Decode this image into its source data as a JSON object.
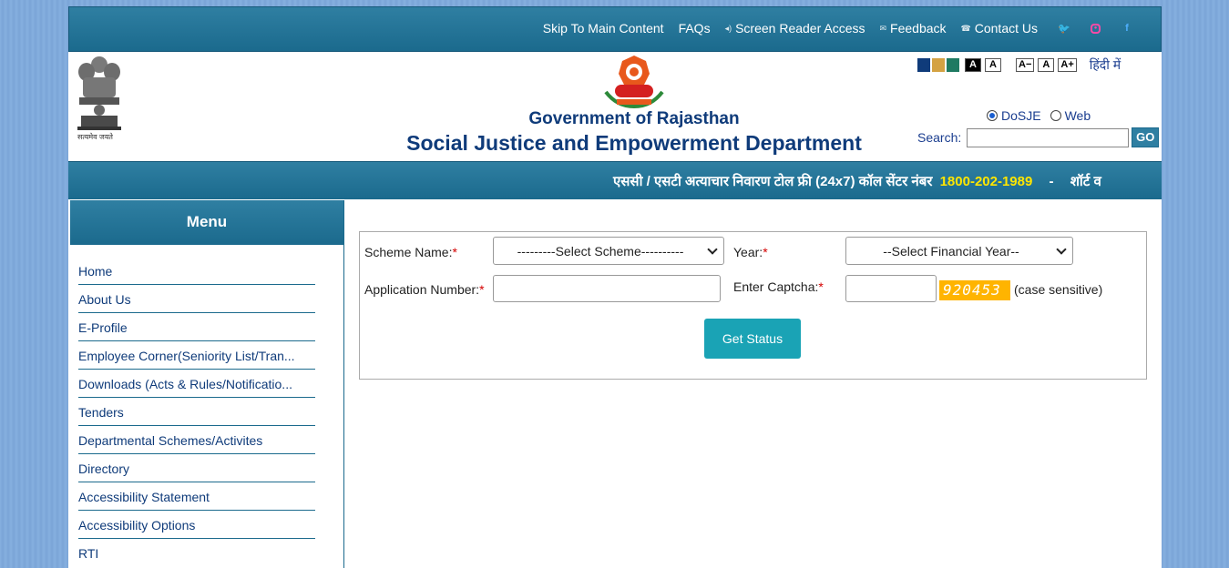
{
  "topnav": {
    "skip": "Skip To Main Content",
    "faqs": "FAQs",
    "screen_reader": "Screen Reader Access",
    "feedback": "Feedback",
    "contact": "Contact Us"
  },
  "header": {
    "emblem_caption": "सत्यमेव जयते",
    "gov_title": "Government of Rajasthan",
    "dept_title": "Social Justice and Empowerment Department"
  },
  "accessibility": {
    "contrast_swatches": [
      "#0f3b7a",
      "#d4a243",
      "#1f7a62"
    ],
    "contrast_dark": "A",
    "contrast_normal": "A",
    "font_decrease": "A−",
    "font_normal": "A",
    "font_increase": "A+",
    "language": "हिंदी में"
  },
  "search": {
    "scope_options": [
      "DoSJE",
      "Web"
    ],
    "selected_scope": "DoSJE",
    "label": "Search:",
    "value": "",
    "go_label": "GO"
  },
  "ticker": {
    "text": "एससी / एसटी अत्याचार निवारण टोल फ्री (24x7) कॉल सेंटर नंबर",
    "number": "1800-202-1989",
    "separator": "-",
    "next": "शॉर्ट व"
  },
  "menu": {
    "title": "Menu",
    "items": [
      "Home",
      "About Us",
      "E-Profile",
      "Employee Corner(Seniority List/Tran...",
      "Downloads (Acts & Rules/Notificatio...",
      "Tenders",
      "Departmental Schemes/Activites",
      "Directory",
      "Accessibility Statement",
      "Accessibility Options",
      "RTI"
    ]
  },
  "form": {
    "scheme_label": "Scheme Name:",
    "scheme_selected": "---------Select Scheme----------",
    "year_label": "Year:",
    "year_selected": "--Select Financial Year--",
    "application_label": "Application Number:",
    "application_value": "",
    "captcha_label": "Enter Captcha:",
    "captcha_value": "",
    "captcha_code": "920453",
    "case_note": "(case sensitive)",
    "required_mark": "*",
    "submit_label": "Get Status"
  }
}
